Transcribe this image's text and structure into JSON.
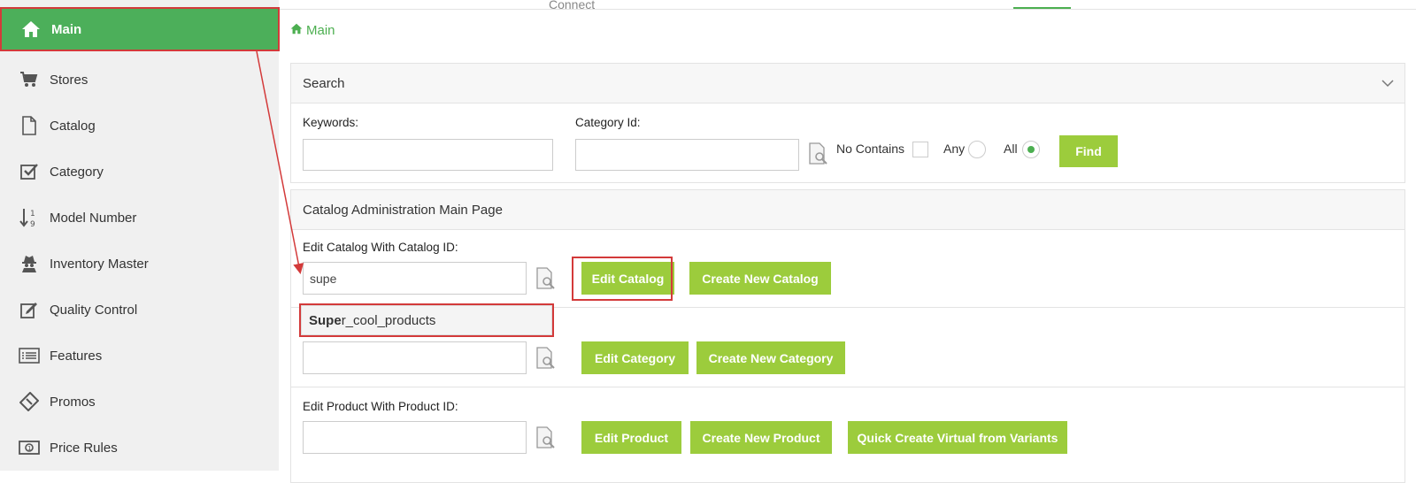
{
  "top": {
    "connect_label": "Connect"
  },
  "sidebar": {
    "items": [
      {
        "label": "Main",
        "icon": "home-icon"
      },
      {
        "label": "Stores",
        "icon": "cart-icon"
      },
      {
        "label": "Catalog",
        "icon": "file-icon"
      },
      {
        "label": "Category",
        "icon": "checkbox-icon"
      },
      {
        "label": "Model Number",
        "icon": "sort-numeric-icon"
      },
      {
        "label": "Inventory Master",
        "icon": "user-secret-icon"
      },
      {
        "label": "Quality Control",
        "icon": "edit-icon"
      },
      {
        "label": "Features",
        "icon": "list-icon"
      },
      {
        "label": "Promos",
        "icon": "ticket-icon"
      },
      {
        "label": "Price Rules",
        "icon": "money-icon"
      }
    ]
  },
  "breadcrumb": {
    "label": "Main"
  },
  "search": {
    "title": "Search",
    "keywords_label": "Keywords:",
    "keywords_value": "",
    "category_id_label": "Category Id:",
    "category_id_value": "",
    "no_contains_label": "No Contains",
    "any_label": "Any",
    "all_label": "All",
    "selected_option": "All",
    "find_label": "Find"
  },
  "admin": {
    "title": "Catalog Administration Main Page",
    "catalog": {
      "label": "Edit Catalog With Catalog ID:",
      "value": "supe",
      "edit_button": "Edit Catalog",
      "create_button": "Create New Catalog",
      "suggestion_match": "Supe",
      "suggestion_rest": "r_cool_products"
    },
    "category": {
      "edit_button": "Edit Category",
      "create_button": "Create New Category"
    },
    "product": {
      "label": "Edit Product With Product ID:",
      "edit_button": "Edit Product",
      "create_button": "Create New Product",
      "quick_button": "Quick Create Virtual from Variants"
    }
  },
  "colors": {
    "accent_green": "#4caf50",
    "button_green": "#9ccc3c",
    "highlight_red": "#d33a3a"
  }
}
